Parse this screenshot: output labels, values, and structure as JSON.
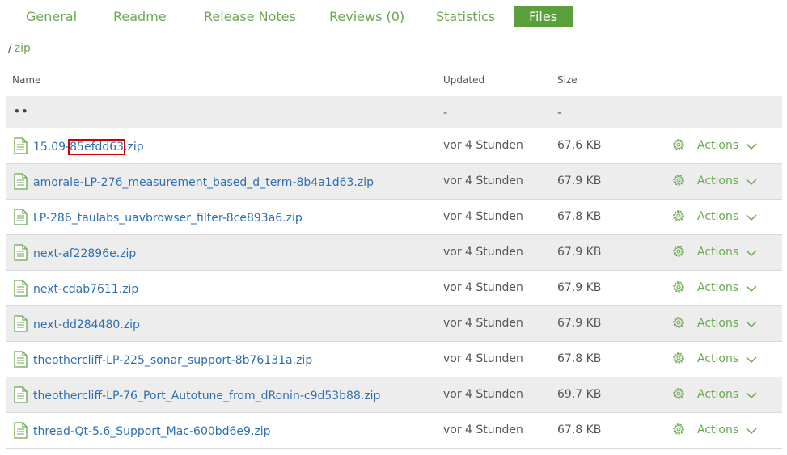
{
  "tabs": [
    {
      "label": "General"
    },
    {
      "label": "Readme"
    },
    {
      "label": "Release Notes"
    },
    {
      "label": "Reviews (0)"
    },
    {
      "label": "Statistics"
    },
    {
      "label": "Files"
    }
  ],
  "breadcrumb": {
    "separator": "/",
    "folder": "zip"
  },
  "table": {
    "headers": {
      "name": "Name",
      "updated": "Updated",
      "size": "Size"
    },
    "parent": {
      "label": "••",
      "updated": "-",
      "size": "-"
    },
    "actions_label": "Actions",
    "rows": [
      {
        "pre": "15.09-",
        "highlight": "85efdd63",
        "post": ".zip",
        "updated": "vor 4 Stunden",
        "size": "67.6 KB"
      },
      {
        "name": "amorale-LP-276_measurement_based_d_term-8b4a1d63.zip",
        "updated": "vor 4 Stunden",
        "size": "67.9 KB"
      },
      {
        "name": "LP-286_taulabs_uavbrowser_filter-8ce893a6.zip",
        "updated": "vor 4 Stunden",
        "size": "67.8 KB"
      },
      {
        "name": "next-af22896e.zip",
        "updated": "vor 4 Stunden",
        "size": "67.9 KB"
      },
      {
        "name": "next-cdab7611.zip",
        "updated": "vor 4 Stunden",
        "size": "67.9 KB"
      },
      {
        "name": "next-dd284480.zip",
        "updated": "vor 4 Stunden",
        "size": "67.9 KB"
      },
      {
        "name": "theothercliff-LP-225_sonar_support-8b76131a.zip",
        "updated": "vor 4 Stunden",
        "size": "67.8 KB"
      },
      {
        "name": "theothercliff-LP-76_Port_Autotune_from_dRonin-c9d53b88.zip",
        "updated": "vor 4 Stunden",
        "size": "69.7 KB"
      },
      {
        "name": "thread-Qt-5.6_Support_Mac-600bd6e9.zip",
        "updated": "vor 4 Stunden",
        "size": "67.8 KB"
      }
    ]
  },
  "colors": {
    "accent": "#6aa84f",
    "active_tab": "#5ca03c",
    "link": "#2f6fb0",
    "highlight_box": "#d00000",
    "row_shade": "#ededed"
  },
  "icons": {
    "file": "file-text-icon",
    "gear": "gear-icon",
    "chevron": "chevron-down-icon"
  }
}
